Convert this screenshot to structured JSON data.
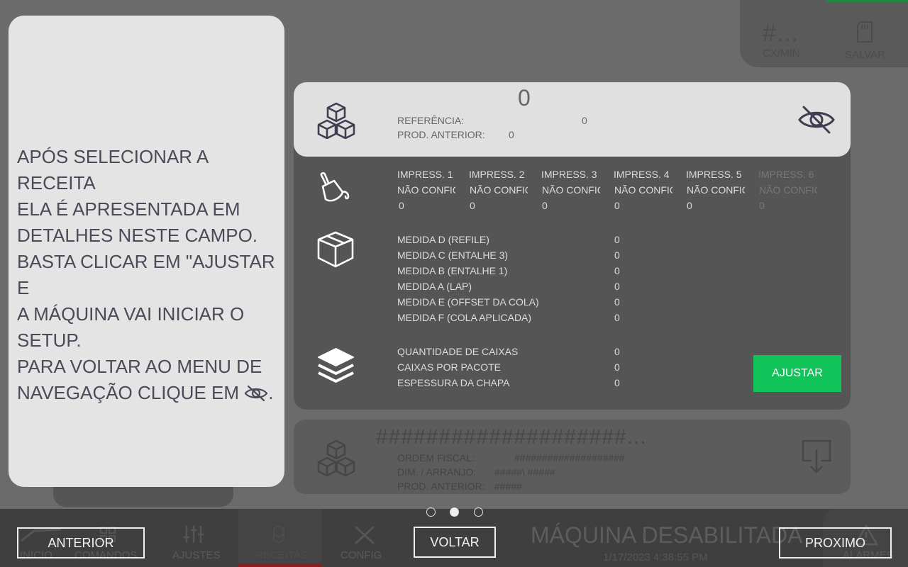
{
  "background": {
    "top_right": {
      "rate_value": "#...",
      "rate_label": "CX/MIN",
      "save_label": "SALVAR"
    },
    "bottom_nav": [
      "INICIO",
      "COMANDOS",
      "AJUSTES",
      "RECEITAS",
      "CONFIG",
      "ALARMES"
    ],
    "status": "MÁQUINA DESABILITADA",
    "datetime": "1/17/2023 4:38:55 PM",
    "lower_card": {
      "title": "####################...",
      "rows": [
        {
          "label": "ORDEM FISCAL:",
          "value": "####################"
        },
        {
          "label": "DIM. / ARRANJO:",
          "value": "#####\\ #####"
        },
        {
          "label": "PROD. ANTERIOR:",
          "value": "#####"
        }
      ]
    }
  },
  "recipe": {
    "header": {
      "number": "0",
      "ref_label": "REFERÊNCIA:",
      "ref_value": "0",
      "prev_label": "PROD. ANTERIOR:",
      "prev_value": "0"
    },
    "printers": [
      {
        "name": "IMPRESS. 1",
        "status": "NÃO CONFIGURADO",
        "value": "0"
      },
      {
        "name": "IMPRESS. 2",
        "status": "NÃO CONFIGURADO",
        "value": "0"
      },
      {
        "name": "IMPRESS. 3",
        "status": "NÃO CONFIGURADO",
        "value": "0"
      },
      {
        "name": "IMPRESS. 4",
        "status": "NÃO CONFIGURADO",
        "value": "0"
      },
      {
        "name": "IMPRESS. 5",
        "status": "NÃO CONFIGURADO",
        "value": "0"
      },
      {
        "name": "IMPRESS. 6",
        "status": "NÃO CONFIGURADO",
        "value": "0"
      }
    ],
    "measures": [
      {
        "label": "MEDIDA D (REFILE)",
        "value": "0"
      },
      {
        "label": "MEDIDA C (ENTALHE 3)",
        "value": "0"
      },
      {
        "label": "MEDIDA B (ENTALHE 1)",
        "value": "0"
      },
      {
        "label": "MEDIDA A (LAP)",
        "value": "0"
      },
      {
        "label": "MEDIDA E (OFFSET DA COLA)",
        "value": "0"
      },
      {
        "label": "MEDIDA F (COLA APLICADA)",
        "value": "0"
      }
    ],
    "quantities": [
      {
        "label": "QUANTIDADE DE CAIXAS",
        "value": "0"
      },
      {
        "label": "CAIXAS POR PACOTE",
        "value": "0"
      },
      {
        "label": "ESPESSURA DA CHAPA",
        "value": "0"
      }
    ],
    "adjust_label": "AJUSTAR"
  },
  "tutorial": {
    "text_main": "APÓS SELECIONAR A RECEITA\nELA É APRESENTADA EM\nDETALHES NESTE CAMPO.\nBASTA CLICAR EM \"AJUSTAR E\nA MÁQUINA VAI INICIAR O\nSETUP.\nPARA VOLTAR AO MENU DE\nNAVEGAÇÃO CLIQUE EM ",
    "text_end": ".",
    "pages": 3,
    "current_page": 2,
    "prev_label": "ANTERIOR",
    "back_label": "VOLTAR",
    "next_label": "PROXIMO"
  },
  "colors": {
    "accent_green": "#10c45a",
    "overlay_panel": "#e4e4e4",
    "text_dark": "#4a4a58"
  }
}
